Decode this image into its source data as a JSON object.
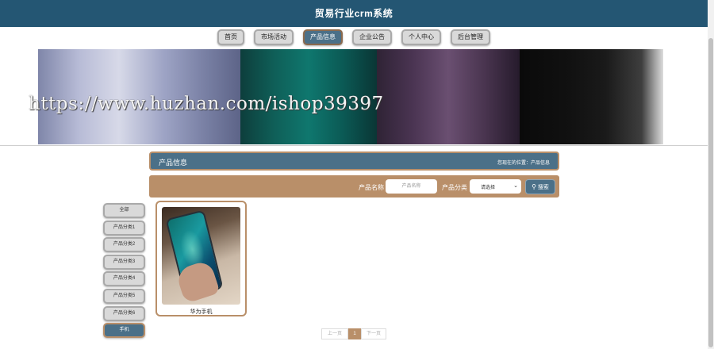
{
  "header": {
    "title": "贸易行业crm系统"
  },
  "nav": {
    "items": [
      {
        "label": "首页"
      },
      {
        "label": "市场活动"
      },
      {
        "label": "产品信息"
      },
      {
        "label": "企业公告"
      },
      {
        "label": "个人中心"
      },
      {
        "label": "后台管理"
      }
    ],
    "active_index": 2
  },
  "banner": {
    "watermark": "https://www.huzhan.com/ishop39397"
  },
  "info_bar": {
    "title": "产品信息",
    "breadcrumb": "您现在的位置：产品信息"
  },
  "search": {
    "name_label": "产品名称",
    "name_placeholder": "产品名称",
    "category_label": "产品分类",
    "category_selected": "请选择",
    "button_label": "搜索"
  },
  "categories": {
    "items": [
      {
        "label": "全部"
      },
      {
        "label": "产品分类1"
      },
      {
        "label": "产品分类2"
      },
      {
        "label": "产品分类3"
      },
      {
        "label": "产品分类4"
      },
      {
        "label": "产品分类5"
      },
      {
        "label": "产品分类6"
      },
      {
        "label": "手机"
      }
    ],
    "active_index": 7
  },
  "products": [
    {
      "name": "华为手机",
      "image": "phone-photo"
    }
  ],
  "pagination": {
    "prev_label": "上一页",
    "current": "1",
    "next_label": "下一页"
  },
  "colors": {
    "primary": "#245673",
    "accent_blue": "#4b7088",
    "accent_tan": "#b98f69",
    "button_gray": "#d9d9d9"
  }
}
